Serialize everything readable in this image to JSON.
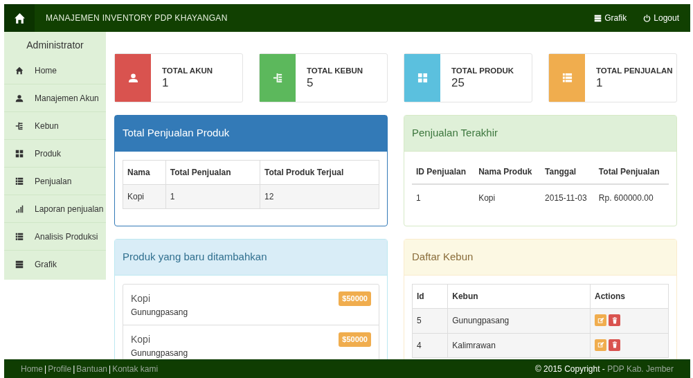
{
  "navbar": {
    "brand": "MANAJEMEN INVENTORY PDP KHAYANGAN",
    "links": [
      {
        "label": "Grafik",
        "kind": "stack"
      },
      {
        "label": "Logout",
        "kind": "power"
      }
    ]
  },
  "sidebar": {
    "title": "Administrator",
    "items": [
      {
        "label": "Home",
        "kind": "home"
      },
      {
        "label": "Manajemen Akun",
        "kind": "user"
      },
      {
        "label": "Kebun",
        "kind": "indent"
      },
      {
        "label": "Produk",
        "kind": "grid"
      },
      {
        "label": "Penjualan",
        "kind": "list"
      },
      {
        "label": "Laporan penjualan",
        "kind": "signal"
      },
      {
        "label": "Analisis Produksi",
        "kind": "list"
      },
      {
        "label": "Grafik",
        "kind": "stack"
      }
    ]
  },
  "stats": [
    {
      "label": "TOTAL AKUN",
      "value": "1",
      "kind": "user",
      "color": "#d9534f"
    },
    {
      "label": "TOTAL KEBUN",
      "value": "5",
      "kind": "indent",
      "color": "#5cb85c"
    },
    {
      "label": "TOTAL PRODUK",
      "value": "25",
      "kind": "grid",
      "color": "#5bc0de"
    },
    {
      "label": "TOTAL PENJUALAN",
      "value": "1",
      "kind": "list",
      "color": "#f0ad4e"
    }
  ],
  "panels": [
    {
      "title": "Total Penjualan Produk",
      "kind": "grid-table",
      "color": "#337ab7",
      "columns": [
        "Nama",
        "Total Penjualan",
        "Total Produk Terjual"
      ],
      "rows": [
        [
          "Kopi",
          "1",
          "12"
        ]
      ]
    },
    {
      "title": "Penjualan Terakhir",
      "kind": "plain-table",
      "color": "#dff0d8",
      "columns": [
        "ID Penjualan",
        "Nama Produk",
        "Tanggal",
        "Total Penjualan"
      ],
      "rows": [
        [
          "1",
          "Kopi",
          "2015-11-03",
          "Rp. 600000.00"
        ]
      ]
    },
    {
      "title": "Produk yang baru ditambahkan",
      "kind": "products",
      "color": "#d9edf7",
      "items": [
        {
          "name": "Kopi",
          "place": "Gunungpasang",
          "price": "$50000"
        },
        {
          "name": "Kopi",
          "place": "Gunungpasang",
          "price": "$50000"
        }
      ]
    },
    {
      "title": "Daftar Kebun",
      "kind": "actions",
      "color": "#fcf8e3",
      "columns": [
        "Id",
        "Kebun",
        "Actions"
      ],
      "rows": [
        [
          "5",
          "Gunungpasang"
        ],
        [
          "4",
          "Kalimrawan"
        ]
      ]
    }
  ],
  "footer": {
    "links": [
      "Home",
      "Profile",
      "Bantuan",
      "Kontak kami"
    ],
    "separator": "|",
    "copyright": "© 2015 Copyright -",
    "owner": "PDP Kab. Jember"
  }
}
